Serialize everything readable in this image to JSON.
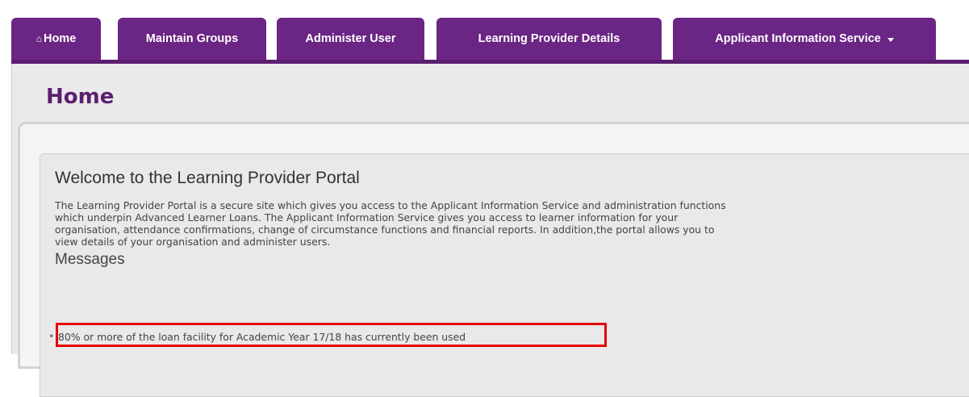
{
  "nav": {
    "tabs": [
      {
        "label": "Home",
        "icon": "home-icon",
        "active": true
      },
      {
        "label": "Maintain Groups"
      },
      {
        "label": "Administer User"
      },
      {
        "label": "Learning Provider Details"
      },
      {
        "label": "Applicant Information Service",
        "dropdown": true
      }
    ],
    "home_icon_glyph": "⌂",
    "accent_color": "#6b2584"
  },
  "page": {
    "title": "Home"
  },
  "welcome": {
    "title": "Welcome to the Learning Provider Portal",
    "intro_lines": [
      "The Learning Provider Portal is a secure site which gives you access to the Applicant Information Service and administration functions",
      "which underpin Advanced Learner Loans. The Applicant Information Service gives you access to learner information for your",
      "organisation, attendance confirmations, change of circumstance functions and financial reports. In addition,the portal allows you to",
      "view details of your organisation and administer users."
    ]
  },
  "messages": {
    "title": "Messages",
    "items": [
      "80% or more of the loan facility for Academic Year 17/18 has currently been used"
    ],
    "highlight_color": "#e60000"
  }
}
